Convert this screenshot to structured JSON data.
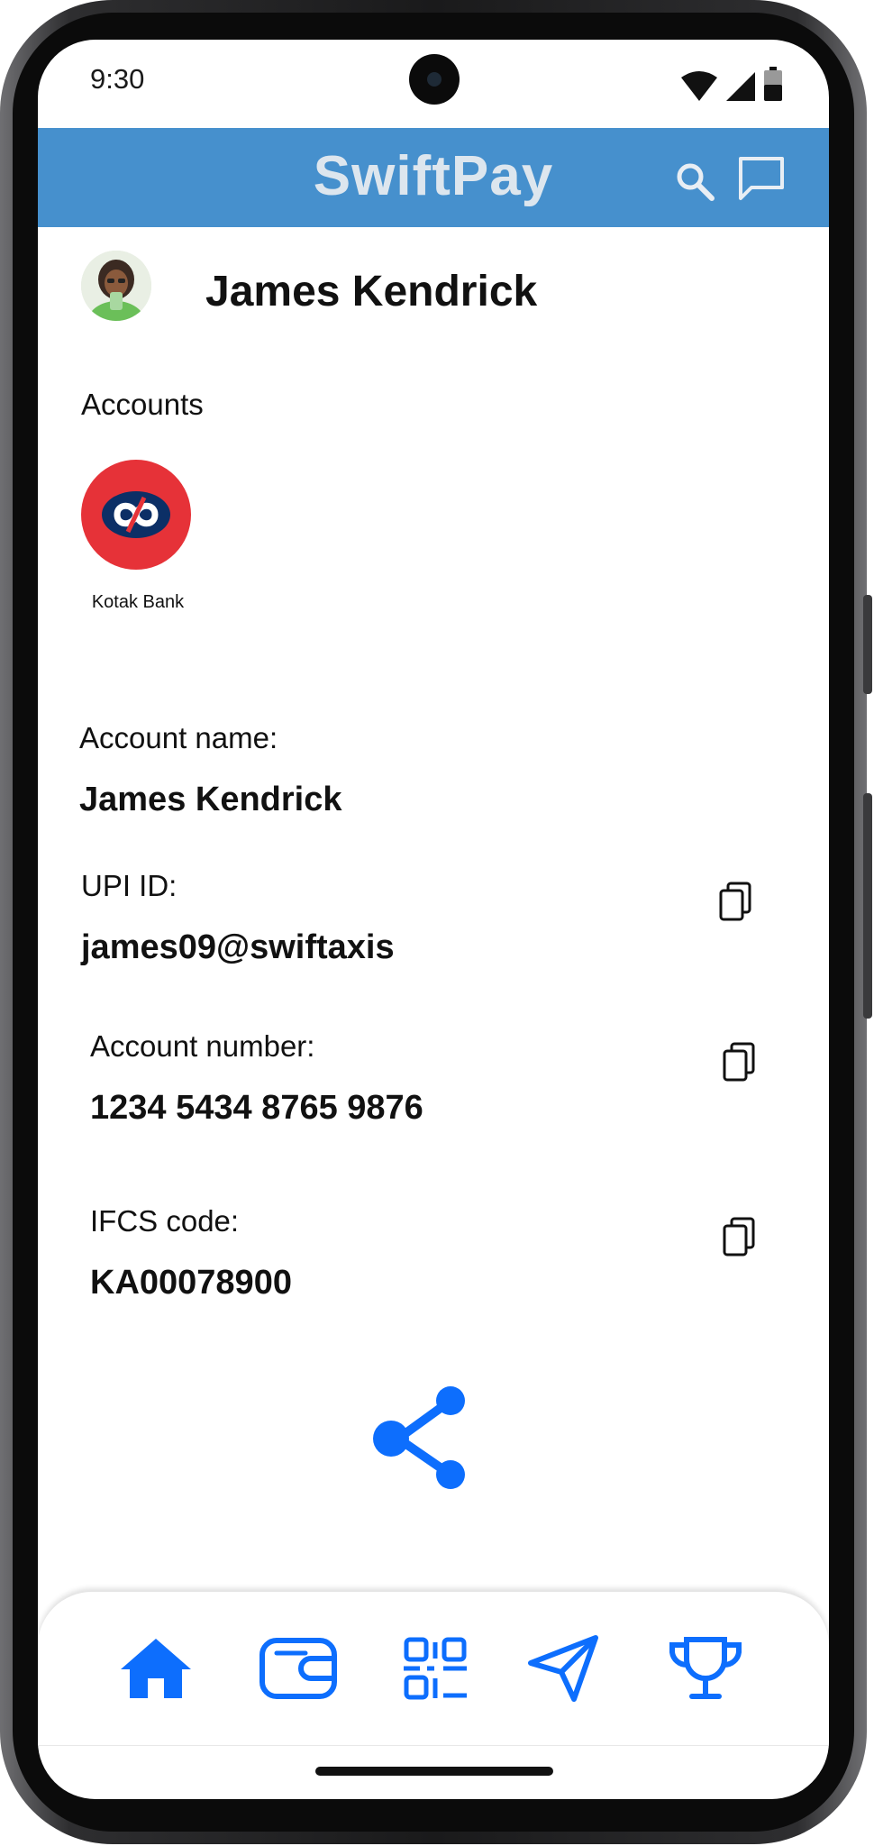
{
  "status": {
    "time": "9:30"
  },
  "header": {
    "title": "SwiftPay",
    "accent_color": "#4690cd"
  },
  "profile": {
    "name": "James Kendrick"
  },
  "accounts": {
    "label": "Accounts",
    "items": [
      {
        "name": "Kotak Bank",
        "logo_color": "#e63238"
      }
    ]
  },
  "details": {
    "account_name_label": "Account name:",
    "account_name_value": "James Kendrick",
    "upi_label": "UPI ID:",
    "upi_value": "james09@swiftaxis",
    "account_number_label": "Account number:",
    "account_number_value": "1234 5434 8765 9876",
    "ifsc_label": "IFCS code:",
    "ifsc_value": "KA00078900"
  },
  "icons": {
    "header": [
      "search-icon",
      "chat-icon"
    ],
    "copy": "copy-icon",
    "share": "share-icon",
    "nav": [
      "home-icon",
      "wallet-icon",
      "qr-scan-icon",
      "send-icon",
      "trophy-icon"
    ]
  },
  "nav_color": "#0d6efd"
}
